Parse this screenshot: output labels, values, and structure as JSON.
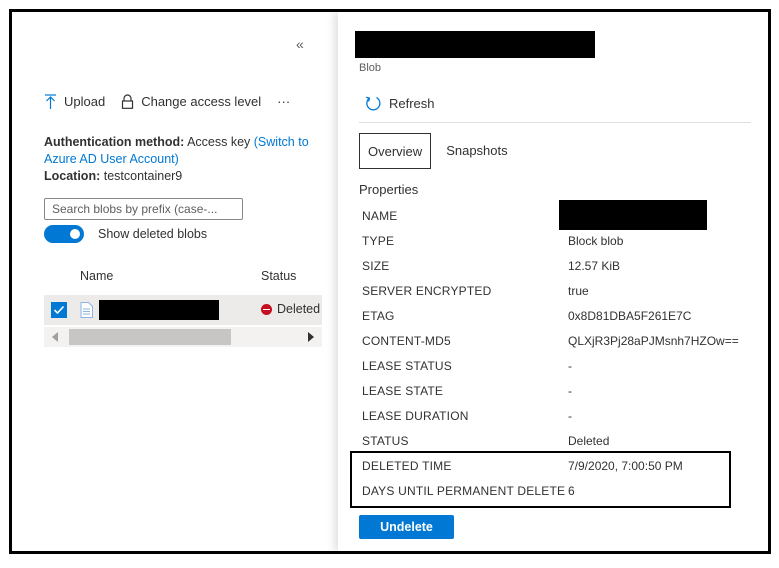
{
  "left": {
    "collapse_glyph": "«",
    "toolbar": {
      "upload_label": "Upload",
      "change_access_label": "Change access level",
      "more_label": "···"
    },
    "auth": {
      "method_label": "Authentication method:",
      "method_value": "Access key",
      "switch_link": "(Switch to Azure AD User Account)",
      "location_label": "Location:",
      "location_value": "testcontainer9"
    },
    "search": {
      "placeholder": "Search blobs by prefix (case-..."
    },
    "show_deleted": {
      "label": "Show deleted blobs",
      "on": true
    },
    "table": {
      "headers": {
        "name": "Name",
        "status": "Status"
      },
      "rows": [
        {
          "status": "Deleted",
          "selected": true
        }
      ]
    }
  },
  "right": {
    "subtitle": "Blob",
    "refresh_label": "Refresh",
    "tabs": [
      {
        "label": "Overview",
        "active": true
      },
      {
        "label": "Snapshots",
        "active": false
      }
    ],
    "properties_heading": "Properties",
    "properties": [
      {
        "key": "NAME",
        "value": ""
      },
      {
        "key": "TYPE",
        "value": "Block blob"
      },
      {
        "key": "SIZE",
        "value": "12.57 KiB"
      },
      {
        "key": "SERVER ENCRYPTED",
        "value": "true"
      },
      {
        "key": "ETAG",
        "value": "0x8D81DBA5F261E7C"
      },
      {
        "key": "CONTENT-MD5",
        "value": "QLXjR3Pj28aPJMsnh7HZOw=="
      },
      {
        "key": "LEASE STATUS",
        "value": "-"
      },
      {
        "key": "LEASE STATE",
        "value": "-"
      },
      {
        "key": "LEASE DURATION",
        "value": "-"
      },
      {
        "key": "STATUS",
        "value": "Deleted"
      },
      {
        "key": "DELETED TIME",
        "value": "7/9/2020, 7:00:50 PM"
      },
      {
        "key": "DAYS UNTIL PERMANENT DELETE",
        "value": "6"
      }
    ],
    "undelete_label": "Undelete"
  },
  "colors": {
    "accent": "#0078d4",
    "deleted_status": "#c50f1f"
  }
}
